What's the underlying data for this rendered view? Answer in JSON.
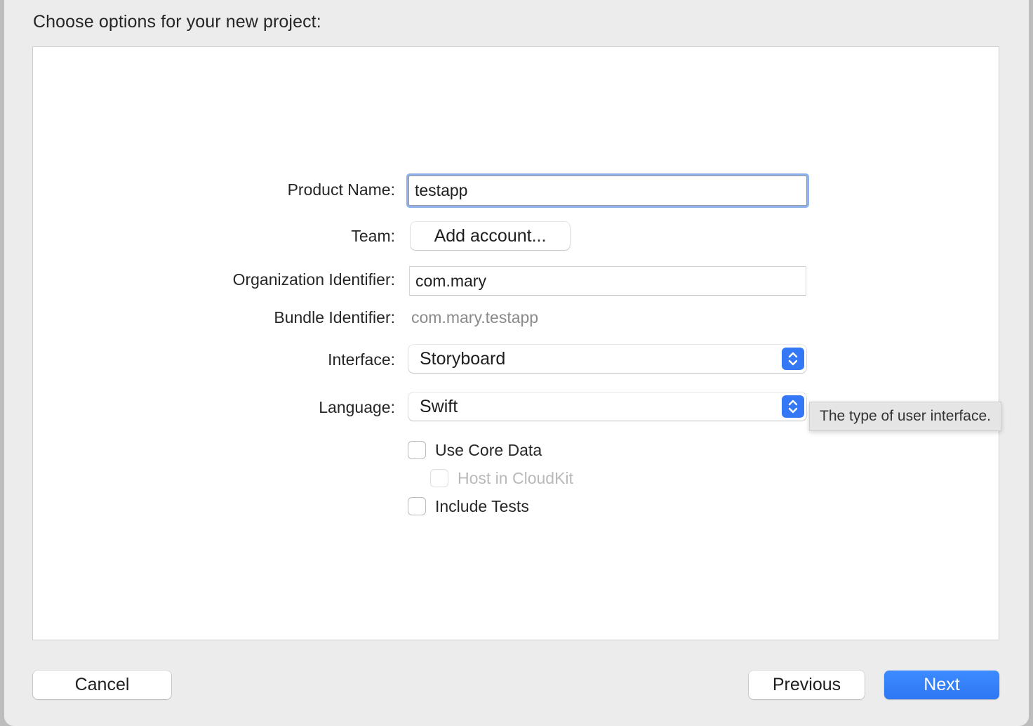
{
  "dialog": {
    "title": "Choose options for your new project:"
  },
  "form": {
    "product_name": {
      "label": "Product Name:",
      "value": "testapp"
    },
    "team": {
      "label": "Team:",
      "button_label": "Add account..."
    },
    "organization_identifier": {
      "label": "Organization Identifier:",
      "value": "com.mary"
    },
    "bundle_identifier": {
      "label": "Bundle Identifier:",
      "value": "com.mary.testapp"
    },
    "interface": {
      "label": "Interface:",
      "selected": "Storyboard"
    },
    "language": {
      "label": "Language:",
      "selected": "Swift"
    },
    "checkboxes": {
      "use_core_data": {
        "label": "Use Core Data",
        "checked": false
      },
      "host_in_cloudkit": {
        "label": "Host in CloudKit",
        "checked": false,
        "disabled": true
      },
      "include_tests": {
        "label": "Include Tests",
        "checked": false
      }
    }
  },
  "tooltip": {
    "text": "The type of user interface."
  },
  "footer": {
    "cancel_label": "Cancel",
    "previous_label": "Previous",
    "next_label": "Next"
  },
  "colors": {
    "accent": "#3478f6",
    "focus_ring": "#8fb2ec",
    "background": "#ececec"
  },
  "icons": {
    "popup_indicator": "chevron-up-down-icon"
  }
}
